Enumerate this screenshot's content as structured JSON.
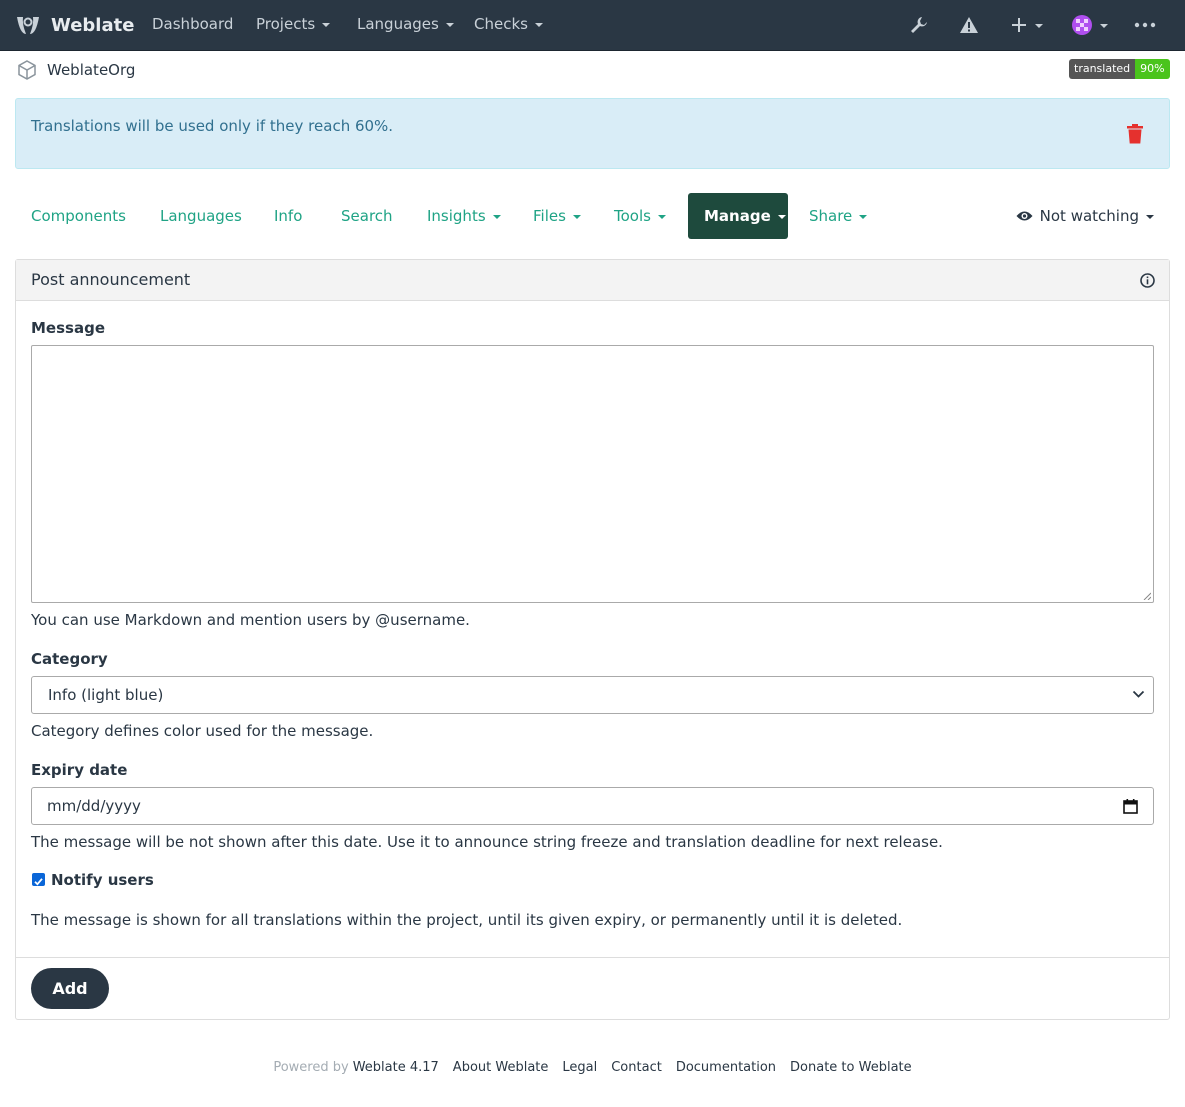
{
  "navbar": {
    "brand": "Weblate",
    "items": [
      {
        "label": "Dashboard",
        "dropdown": false
      },
      {
        "label": "Projects",
        "dropdown": true
      },
      {
        "label": "Languages",
        "dropdown": true
      },
      {
        "label": "Checks",
        "dropdown": true
      }
    ],
    "icons": [
      "wrench-icon",
      "warning-icon",
      "plus-icon",
      "avatar",
      "more-icon"
    ]
  },
  "breadcrumb": {
    "project": "WeblateOrg"
  },
  "badge": {
    "label": "translated",
    "value": "90%",
    "color": "#4ac41c"
  },
  "alert": {
    "text": "Translations will be used only if they reach 60%.",
    "color": "#d9edf7"
  },
  "tabs": {
    "items": [
      {
        "label": "Components",
        "dropdown": false
      },
      {
        "label": "Languages",
        "dropdown": false
      },
      {
        "label": "Info",
        "dropdown": false
      },
      {
        "label": "Search",
        "dropdown": false
      },
      {
        "label": "Insights",
        "dropdown": true
      },
      {
        "label": "Files",
        "dropdown": true
      },
      {
        "label": "Tools",
        "dropdown": true
      },
      {
        "label": "Manage",
        "dropdown": true,
        "active": true
      },
      {
        "label": "Share",
        "dropdown": true
      }
    ],
    "watch": "Not watching"
  },
  "form": {
    "title": "Post announcement",
    "message_label": "Message",
    "message_value": "",
    "message_help": "You can use Markdown and mention users by @username.",
    "category_label": "Category",
    "category_value": "Info (light blue)",
    "category_help": "Category defines color used for the message.",
    "expiry_label": "Expiry date",
    "expiry_placeholder": "mm/dd/yyyy",
    "expiry_help": "The message will be not shown after this date. Use it to announce string freeze and translation deadline for next release.",
    "notify_label": "Notify users",
    "notify_checked": true,
    "scope_help": "The message is shown for all translations within the project, until its given expiry, or permanently until it is deleted.",
    "submit_label": "Add"
  },
  "footer": {
    "powered_by": "Powered by",
    "links": [
      "Weblate 4.17",
      "About Weblate",
      "Legal",
      "Contact",
      "Documentation",
      "Donate to Weblate"
    ]
  },
  "colors": {
    "navbar": "#2a3744",
    "accent": "#1fa385",
    "active_tab": "#1e4a3d",
    "danger": "#e5312e"
  }
}
